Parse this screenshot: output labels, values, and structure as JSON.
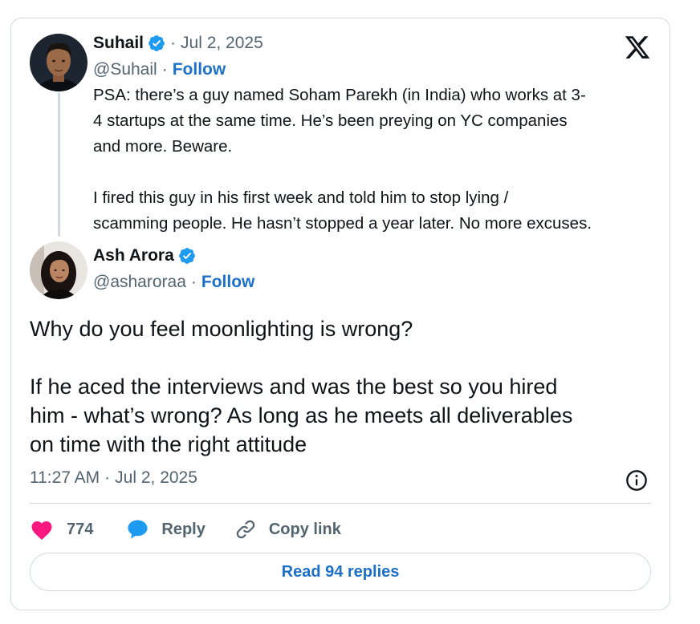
{
  "quoted_tweet": {
    "author_name": "Suhail",
    "date": "Jul 2, 2025",
    "handle": "@Suhail",
    "follow_label": "Follow",
    "paragraphs": [
      "PSA: there’s a guy named Soham Parekh (in India) who works at 3-\n4 startups at the same time. He’s been preying on YC companies\nand more. Beware.",
      "I fired this guy in his first week and told him to stop lying /\nscamming people. He hasn’t stopped a year later. No more excuses."
    ]
  },
  "reply_tweet": {
    "author_name": "Ash Arora",
    "handle": "@asharoraa",
    "follow_label": "Follow",
    "paragraphs": [
      "Why do you feel moonlighting is wrong?",
      "If he aced the interviews and was the best so you hired\nhim - what’s wrong? As long as he meets all deliverables\non time with the right attitude"
    ],
    "time": "11:27 AM",
    "date": "Jul 2, 2025"
  },
  "actions": {
    "like_count": "774",
    "reply_label": "Reply",
    "copy_link_label": "Copy link"
  },
  "read_replies_label": "Read 94 replies",
  "icons": {
    "brand": "x-logo-icon",
    "verified": "verified-badge-icon",
    "like": "heart-icon",
    "reply": "speech-bubble-icon",
    "copy": "link-icon",
    "info": "info-icon"
  },
  "colors": {
    "accent": "#1d70c8",
    "verified": "#1d9bf0",
    "like": "#f91880",
    "muted": "#536471",
    "border": "#cfd9de"
  }
}
